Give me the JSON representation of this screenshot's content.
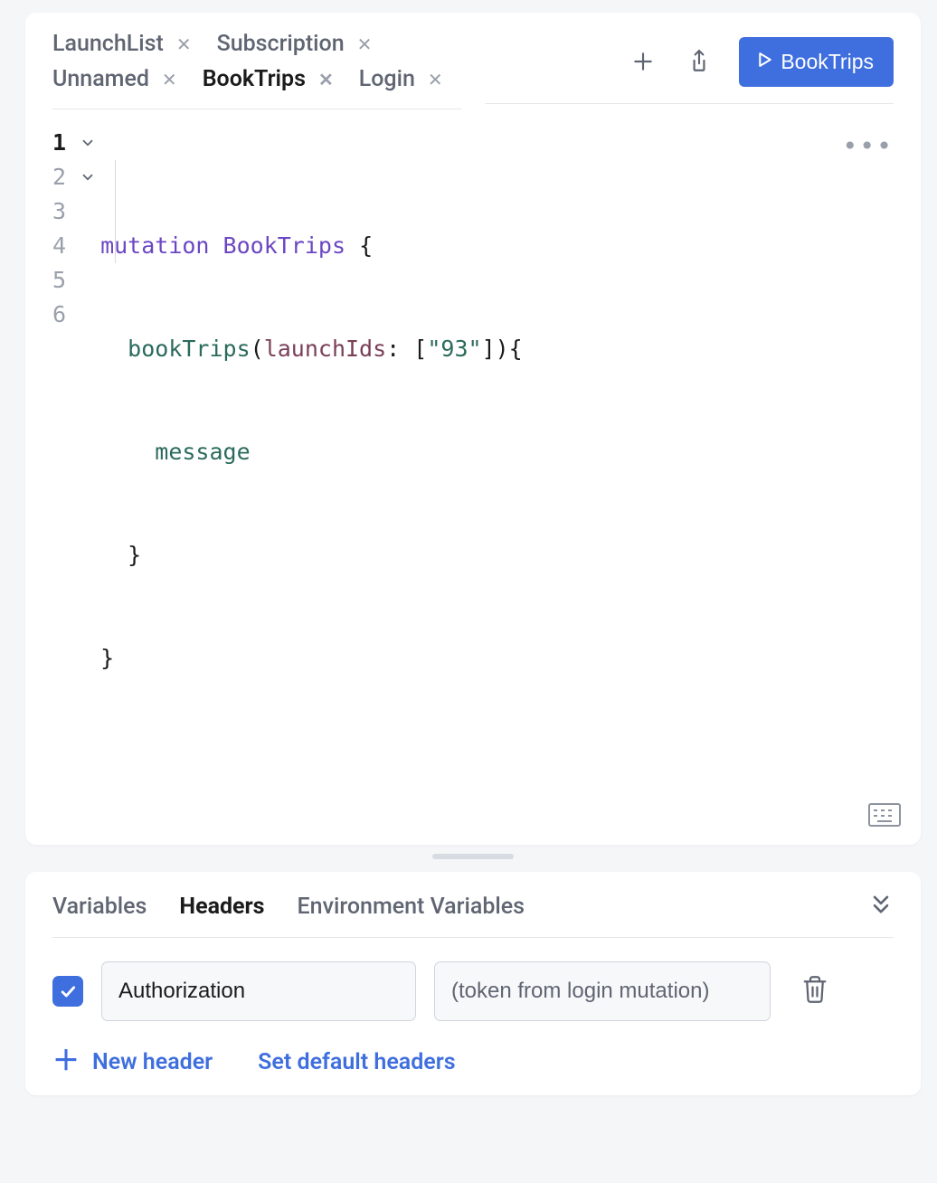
{
  "tabs": {
    "items": [
      {
        "label": "LaunchList",
        "active": false
      },
      {
        "label": "Subscription",
        "active": false
      },
      {
        "label": "Unnamed",
        "active": false
      },
      {
        "label": "BookTrips",
        "active": true
      },
      {
        "label": "Login",
        "active": false
      }
    ]
  },
  "run_button": {
    "label": "BookTrips"
  },
  "editor": {
    "line_numbers": [
      "1",
      "2",
      "3",
      "4",
      "5",
      "6"
    ],
    "code": {
      "l1_keyword": "mutation",
      "l1_name": "BookTrips",
      "l1_open": " {",
      "l2_call": "bookTrips",
      "l2_arg": "launchIds",
      "l2_colon": ":",
      "l2_str": "\"93\"",
      "l3_field": "message",
      "l4_close": "}",
      "l5_close": "}"
    }
  },
  "bottom": {
    "tabs": {
      "variables": "Variables",
      "headers": "Headers",
      "env": "Environment Variables"
    },
    "header_row": {
      "checked": true,
      "key": "Authorization",
      "value": "(token from login mutation)"
    },
    "actions": {
      "new_header": "New header",
      "set_default": "Set default headers"
    }
  }
}
